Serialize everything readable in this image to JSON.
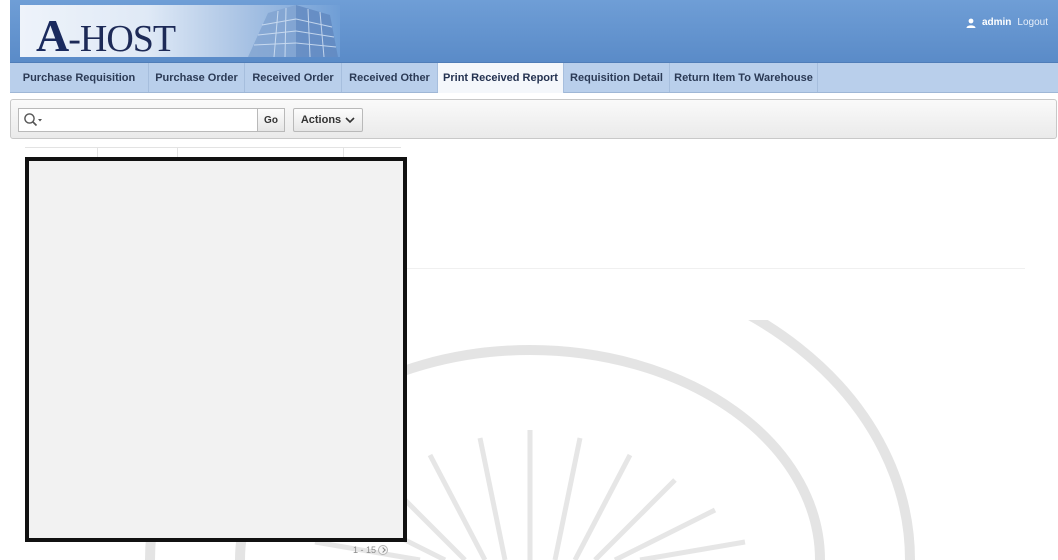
{
  "header": {
    "logo_text": "-HOST",
    "logo_letter": "A",
    "user_name": "admin",
    "logout_label": "Logout"
  },
  "nav": {
    "tabs": [
      {
        "label": "Purchase Requisition",
        "active": false
      },
      {
        "label": "Purchase Order",
        "active": false
      },
      {
        "label": "Received Order",
        "active": false
      },
      {
        "label": "Received Other",
        "active": false
      },
      {
        "label": "Print Received Report",
        "active": true
      },
      {
        "label": "Requisition Detail",
        "active": false
      },
      {
        "label": "Return Item To Warehouse",
        "active": false
      }
    ]
  },
  "toolbar": {
    "search_value": "",
    "go_label": "Go",
    "actions_label": "Actions"
  },
  "report": {
    "pagination_text": "1 - 15"
  },
  "colors": {
    "header_bg": "#5a8bc8",
    "nav_bg": "#b9cfeb",
    "active_tab_bg": "#f4f7fb",
    "redaction_fill": "#f2f2f2"
  }
}
